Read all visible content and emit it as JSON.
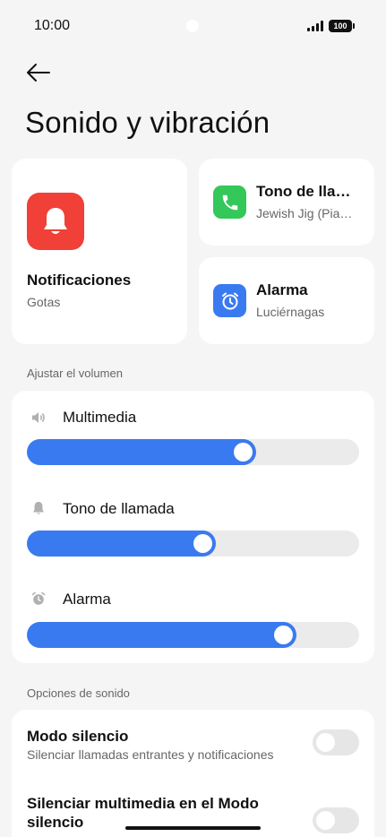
{
  "status_bar": {
    "time": "10:00",
    "battery": "100"
  },
  "page": {
    "title": "Sonido y vibración"
  },
  "cards": {
    "notifications": {
      "title": "Notificaciones",
      "subtitle": "Gotas",
      "icon": "bell-icon",
      "color": "#f04037"
    },
    "ringtone": {
      "title": "Tono de lla…",
      "subtitle": "Jewish Jig (Pia…",
      "icon": "phone-icon",
      "color": "#34c759"
    },
    "alarm": {
      "title": "Alarma",
      "subtitle": "Luciérnagas",
      "icon": "alarm-clock-icon",
      "color": "#3a7af0"
    }
  },
  "volume": {
    "section_label": "Ajustar el volumen",
    "rows": [
      {
        "label": "Multimedia",
        "icon": "speaker-icon",
        "level": 0.69
      },
      {
        "label": "Tono de llamada",
        "icon": "bell-icon",
        "level": 0.57
      },
      {
        "label": "Alarma",
        "icon": "alarm-clock-icon",
        "level": 0.81
      }
    ]
  },
  "options": {
    "section_label": "Opciones de sonido",
    "items": [
      {
        "title": "Modo silencio",
        "subtitle": "Silenciar llamadas entrantes y notificaciones",
        "enabled": false
      },
      {
        "title": "Silenciar multimedia en el Modo silencio",
        "enabled": false
      }
    ]
  },
  "colors": {
    "accent": "#3a7af0",
    "background": "#f5f5f5",
    "card": "#ffffff"
  }
}
